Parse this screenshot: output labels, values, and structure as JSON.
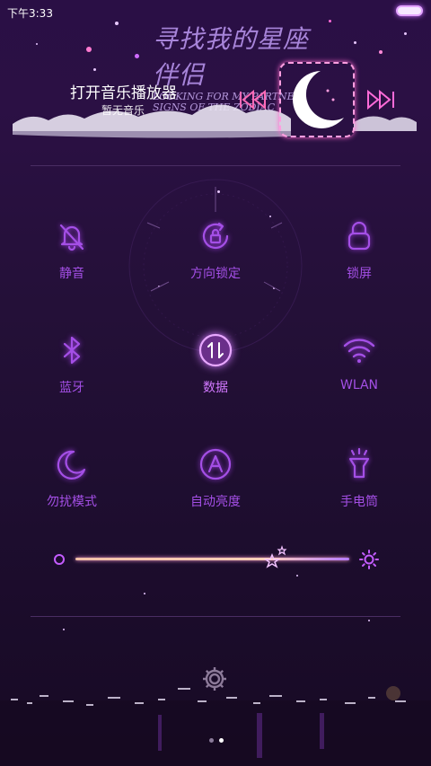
{
  "status_bar": {
    "time": "下午3:33"
  },
  "banner": {
    "title_cn": "寻找我的星座伴侣",
    "title_en_1": "LOOKING FOR MY PARTNER",
    "title_en_2": "SIGNS OF THE ZODIAC"
  },
  "music": {
    "title": "打开音乐播放器",
    "subtitle": "暂无音乐"
  },
  "toggles": [
    {
      "label": "静音",
      "icon": "bell-off-icon",
      "active": false
    },
    {
      "label": "方向锁定",
      "icon": "rotation-lock-icon",
      "active": false
    },
    {
      "label": "锁屏",
      "icon": "lock-icon",
      "active": false
    },
    {
      "label": "蓝牙",
      "icon": "bluetooth-icon",
      "active": false
    },
    {
      "label": "数据",
      "icon": "mobile-data-icon",
      "active": true
    },
    {
      "label": "WLAN",
      "icon": "wifi-icon",
      "active": false
    },
    {
      "label": "勿扰模式",
      "icon": "moon-icon",
      "active": false
    },
    {
      "label": "自动亮度",
      "icon": "auto-brightness-icon",
      "active": false
    },
    {
      "label": "手电筒",
      "icon": "flashlight-icon",
      "active": false
    }
  ],
  "brightness": {
    "level": 0.72
  },
  "pager": {
    "pages": 2,
    "current": 2
  },
  "colors": {
    "accent": "#a44fe6",
    "active": "#d278ff",
    "background": "#241038"
  }
}
